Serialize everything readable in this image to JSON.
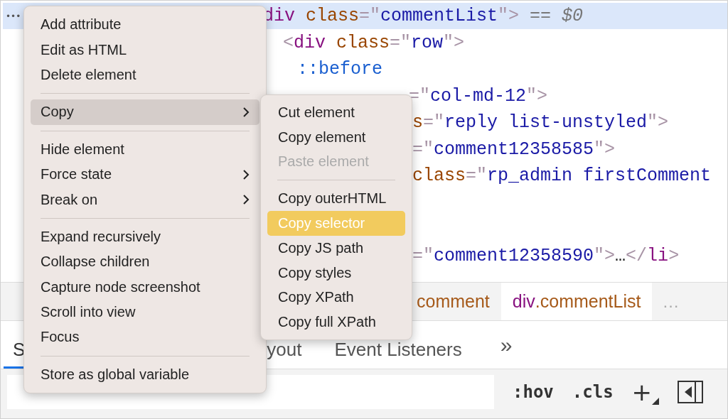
{
  "dom": {
    "lines": [
      {
        "gutter": "•••",
        "selected": true,
        "tokens": [
          {
            "kind": "tag",
            "text": "div"
          },
          {
            "kind": "attr",
            "text": "class"
          },
          {
            "kind": "punct",
            "text": "=\""
          },
          {
            "kind": "value",
            "text": "commentList"
          },
          {
            "kind": "punct",
            "text": "\">"
          },
          {
            "kind": "ref",
            "text": " == $0"
          }
        ]
      },
      {
        "selected": false,
        "tokens": [
          {
            "kind": "punct",
            "text": "<"
          },
          {
            "kind": "tag",
            "text": "div"
          },
          {
            "kind": "attr",
            "text": "class"
          },
          {
            "kind": "punct",
            "text": "=\""
          },
          {
            "kind": "value",
            "text": "row"
          },
          {
            "kind": "punct",
            "text": "\">"
          }
        ]
      },
      {
        "selected": false,
        "tokens": [
          {
            "kind": "pseudo",
            "text": "::before"
          }
        ]
      },
      {
        "selected": false,
        "tokens": [
          {
            "kind": "punct",
            "text": "=\""
          },
          {
            "kind": "value",
            "text": "col-md-12"
          },
          {
            "kind": "punct",
            "text": "\">"
          }
        ]
      },
      {
        "selected": false,
        "tokens": [
          {
            "kind": "attr",
            "text": "s"
          },
          {
            "kind": "punct",
            "text": "=\""
          },
          {
            "kind": "value",
            "text": "reply list-unstyled"
          },
          {
            "kind": "punct",
            "text": "\">"
          }
        ]
      },
      {
        "selected": false,
        "tokens": [
          {
            "kind": "punct",
            "text": "=\""
          },
          {
            "kind": "value",
            "text": "comment12358585"
          },
          {
            "kind": "punct",
            "text": "\">"
          }
        ]
      },
      {
        "selected": false,
        "tokens": [
          {
            "kind": "attr",
            "text": "class"
          },
          {
            "kind": "punct",
            "text": "=\""
          },
          {
            "kind": "value",
            "text": "rp_admin firstComment"
          }
        ]
      },
      {
        "selected": false,
        "tokens": [
          {
            "kind": "punct",
            "text": "=\""
          },
          {
            "kind": "value",
            "text": "comment12358590"
          },
          {
            "kind": "punct",
            "text": "\">"
          },
          {
            "kind": "plain",
            "text": "…"
          },
          {
            "kind": "punct",
            "text": "</"
          },
          {
            "kind": "tag",
            "text": "li"
          },
          {
            "kind": "punct",
            "text": ">"
          }
        ]
      }
    ]
  },
  "breadcrumbs": {
    "items": [
      {
        "cls": "comment",
        "selected": false
      },
      {
        "tag": "div",
        "cls": ".commentList",
        "selected": true
      }
    ],
    "more": "…"
  },
  "tabs": {
    "items": [
      {
        "label": "S",
        "selected": true
      },
      {
        "label": "yout",
        "selected": false
      },
      {
        "label": "Event Listeners",
        "selected": false
      }
    ],
    "more": "»"
  },
  "filter": {
    "hov": ":hov",
    "cls": ".cls",
    "add": "+"
  },
  "menu": {
    "items": [
      {
        "kind": "item",
        "label": "Add attribute",
        "selected": false,
        "submenu": false
      },
      {
        "kind": "item",
        "label": "Edit as HTML",
        "selected": false,
        "submenu": false
      },
      {
        "kind": "item",
        "label": "Delete element",
        "selected": false,
        "submenu": false
      },
      {
        "kind": "separator"
      },
      {
        "kind": "item",
        "label": "Copy",
        "selected": true,
        "submenu": true
      },
      {
        "kind": "separator"
      },
      {
        "kind": "item",
        "label": "Hide element",
        "selected": false,
        "submenu": false
      },
      {
        "kind": "item",
        "label": "Force state",
        "selected": false,
        "submenu": true
      },
      {
        "kind": "item",
        "label": "Break on",
        "selected": false,
        "submenu": true
      },
      {
        "kind": "separator"
      },
      {
        "kind": "item",
        "label": "Expand recursively",
        "selected": false,
        "submenu": false
      },
      {
        "kind": "item",
        "label": "Collapse children",
        "selected": false,
        "submenu": false
      },
      {
        "kind": "item",
        "label": "Capture node screenshot",
        "selected": false,
        "submenu": false
      },
      {
        "kind": "item",
        "label": "Scroll into view",
        "selected": false,
        "submenu": false
      },
      {
        "kind": "item",
        "label": "Focus",
        "selected": false,
        "submenu": false
      },
      {
        "kind": "separator"
      },
      {
        "kind": "item",
        "label": "Store as global variable",
        "selected": false,
        "submenu": false
      }
    ]
  },
  "submenu": {
    "items": [
      {
        "kind": "item",
        "label": "Cut element",
        "selected": false,
        "disabled": false
      },
      {
        "kind": "item",
        "label": "Copy element",
        "selected": false,
        "disabled": false
      },
      {
        "kind": "item",
        "label": "Paste element",
        "selected": false,
        "disabled": true
      },
      {
        "kind": "separator"
      },
      {
        "kind": "item",
        "label": "Copy outerHTML",
        "selected": false,
        "disabled": false
      },
      {
        "kind": "item",
        "label": "Copy selector",
        "selected": true,
        "disabled": false
      },
      {
        "kind": "item",
        "label": "Copy JS path",
        "selected": false,
        "disabled": false
      },
      {
        "kind": "item",
        "label": "Copy styles",
        "selected": false,
        "disabled": false
      },
      {
        "kind": "item",
        "label": "Copy XPath",
        "selected": false,
        "disabled": false
      },
      {
        "kind": "item",
        "label": "Copy full XPath",
        "selected": false,
        "disabled": false
      }
    ]
  }
}
